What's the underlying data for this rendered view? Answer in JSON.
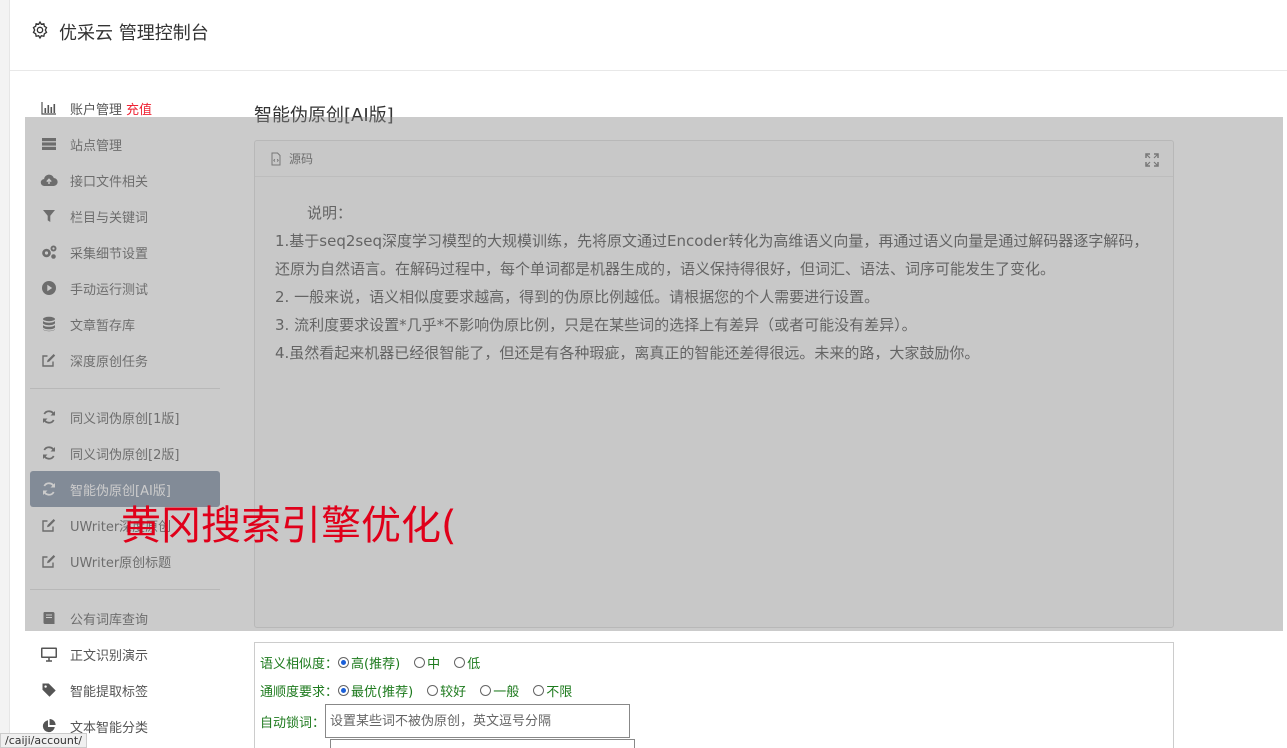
{
  "header": {
    "title": "优采云 管理控制台",
    "icon": "gear-icon"
  },
  "sidebar": {
    "group1": [
      {
        "label": "账户管理",
        "badge": "充值",
        "icon": "bar-chart-icon"
      },
      {
        "label": "站点管理",
        "icon": "server-icon"
      },
      {
        "label": "接口文件相关",
        "icon": "cloud-upload-icon"
      },
      {
        "label": "栏目与关键词",
        "icon": "filter-icon"
      },
      {
        "label": "采集细节设置",
        "icon": "cogs-icon"
      },
      {
        "label": "手动运行测试",
        "icon": "play-circle-icon"
      },
      {
        "label": "文章暂存库",
        "icon": "database-icon"
      },
      {
        "label": "深度原创任务",
        "icon": "edit-icon"
      }
    ],
    "group2": [
      {
        "label": "同义词伪原创[1版]",
        "icon": "refresh-icon"
      },
      {
        "label": "同义词伪原创[2版]",
        "icon": "refresh-icon"
      },
      {
        "label": "智能伪原创[AI版]",
        "icon": "refresh-icon",
        "active": true
      },
      {
        "label": "UWriter深度原创",
        "icon": "edit-icon"
      },
      {
        "label": "UWriter原创标题",
        "icon": "edit-icon"
      }
    ],
    "group3": [
      {
        "label": "公有词库查询",
        "icon": "book-icon"
      },
      {
        "label": "正文识别演示",
        "icon": "monitor-icon"
      },
      {
        "label": "智能提取标签",
        "icon": "tag-icon"
      },
      {
        "label": "文本智能分类",
        "icon": "pie-chart-icon"
      }
    ]
  },
  "main": {
    "title": "智能伪原创[AI版]",
    "panel": {
      "header_label": "源码",
      "description": {
        "intro": "说明：",
        "lines": [
          "1.基于seq2seq深度学习模型的大规模训练，先将原文通过Encoder转化为高维语义向量，再通过语义向量是通过解码器逐字解码，还原为自然语言。在解码过程中，每个单词都是机器生成的，语义保持得很好，但词汇、语法、词序可能发生了变化。",
          "2. 一般来说，语义相似度要求越高，得到的伪原比例越低。请根据您的个人需要进行设置。",
          "3. 流利度要求设置*几乎*不影响伪原比例，只是在某些词的选择上有差异（或者可能没有差异）。",
          "4.虽然看起来机器已经很智能了，但还是有各种瑕疵，离真正的智能还差得很远。未来的路，大家鼓励你。"
        ]
      }
    },
    "watermark": "黄冈搜索引擎优化(",
    "form": {
      "similarity": {
        "label": "语义相似度：",
        "options": [
          "高(推荐)",
          "中",
          "低"
        ],
        "selected": "高(推荐)"
      },
      "fluency": {
        "label": "通顺度要求：",
        "options": [
          "最优(推荐)",
          "较好",
          "一般",
          "不限"
        ],
        "selected": "最优(推荐)"
      },
      "auto_lock": {
        "label": "自动锁词：",
        "placeholder": "设置某些词不被伪原创，英文逗号分隔",
        "value": ""
      }
    }
  },
  "status_bar": {
    "url": "/caiji/account/"
  }
}
